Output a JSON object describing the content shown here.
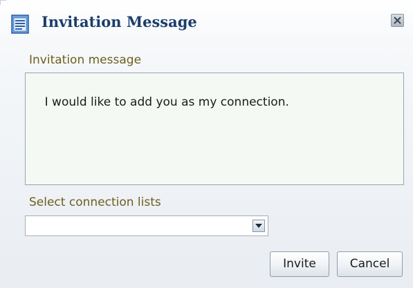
{
  "dialog": {
    "title": "Invitation Message",
    "title_icon": "document-list-icon",
    "close_icon": "close-icon"
  },
  "message": {
    "label": "Invitation message",
    "value": "I would like to add you as my connection."
  },
  "connection_lists": {
    "label": "Select connection lists",
    "selected_value": "",
    "arrow_icon": "chevron-down-icon"
  },
  "buttons": {
    "invite": "Invite",
    "cancel": "Cancel"
  },
  "colors": {
    "title": "#1b3d6b",
    "label": "#6f5d1d",
    "textarea_bg": "#f4f9f4"
  }
}
